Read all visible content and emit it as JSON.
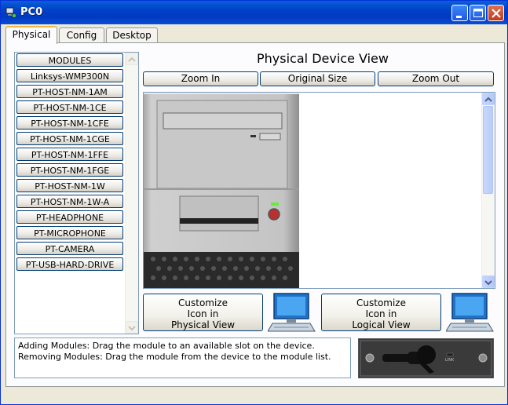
{
  "window": {
    "title": "PC0"
  },
  "tabs": [
    {
      "label": "Physical",
      "active": true
    },
    {
      "label": "Config",
      "active": false
    },
    {
      "label": "Desktop",
      "active": false
    }
  ],
  "modules": {
    "header": "MODULES",
    "items": [
      "Linksys-WMP300N",
      "PT-HOST-NM-1AM",
      "PT-HOST-NM-1CE",
      "PT-HOST-NM-1CFE",
      "PT-HOST-NM-1CGE",
      "PT-HOST-NM-1FFE",
      "PT-HOST-NM-1FGE",
      "PT-HOST-NM-1W",
      "PT-HOST-NM-1W-A",
      "PT-HEADPHONE",
      "PT-MICROPHONE",
      "PT-CAMERA",
      "PT-USB-HARD-DRIVE"
    ]
  },
  "physical_view": {
    "title": "Physical Device View",
    "zoom_in": "Zoom In",
    "original_size": "Original Size",
    "zoom_out": "Zoom Out"
  },
  "customize": {
    "physical": {
      "line1": "Customize",
      "line2": "Icon in",
      "line3": "Physical View"
    },
    "logical": {
      "line1": "Customize",
      "line2": "Icon in",
      "line3": "Logical View"
    }
  },
  "info": {
    "adding": "Adding Modules: Drag the module to an available slot on the device.",
    "removing": "Removing Modules: Drag the module from the device to the module list."
  },
  "module_image": {
    "label": "LINK"
  },
  "colors": {
    "titlebar": "#0040c8",
    "active_tab_accent": "#f4b63f",
    "led_green": "#66ee33",
    "power_button": "#b83030"
  }
}
